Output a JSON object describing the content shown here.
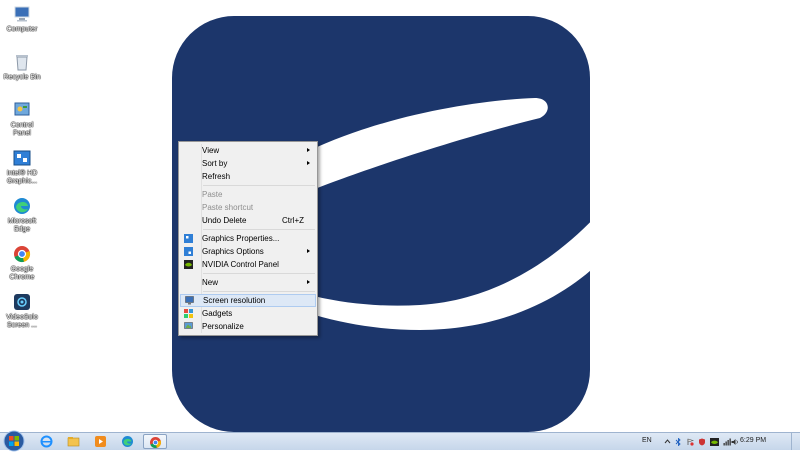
{
  "desktop": {
    "icons": [
      {
        "name": "computer-icon",
        "label": "Computer"
      },
      {
        "name": "recycle-bin-icon",
        "label": "Recycle Bin"
      },
      {
        "name": "control-panel-icon",
        "label": "Control\nPanel"
      },
      {
        "name": "intel-hd-graphics-icon",
        "label": "Intel® HD\nGraphic..."
      },
      {
        "name": "microsoft-edge-icon",
        "label": "Microsoft\nEdge"
      },
      {
        "name": "google-chrome-icon",
        "label": "Google\nChrome"
      },
      {
        "name": "videosolo-screen-icon",
        "label": "VideoSolo\nScreen ..."
      }
    ]
  },
  "context_menu": {
    "view": "View",
    "sort_by": "Sort by",
    "refresh": "Refresh",
    "paste": "Paste",
    "paste_shortcut": "Paste shortcut",
    "undo_delete": "Undo Delete",
    "undo_delete_shortcut": "Ctrl+Z",
    "graphics_properties": "Graphics Properties...",
    "graphics_options": "Graphics Options",
    "nvidia_control_panel": "NVIDIA Control Panel",
    "new": "New",
    "screen_resolution": "Screen resolution",
    "gadgets": "Gadgets",
    "personalize": "Personalize"
  },
  "taskbar": {
    "pinned": [
      "internet-explorer-icon",
      "file-explorer-icon",
      "media-player-icon",
      "microsoft-edge-icon",
      "google-chrome-icon"
    ],
    "tray": {
      "language": "EN",
      "clock": "6:29 PM"
    }
  },
  "colors": {
    "wallpaper_logo": "#1c366b",
    "menu_background": "#f0f0f0",
    "menu_highlight": "#dde8f6",
    "taskbar": "#cfdcec"
  }
}
